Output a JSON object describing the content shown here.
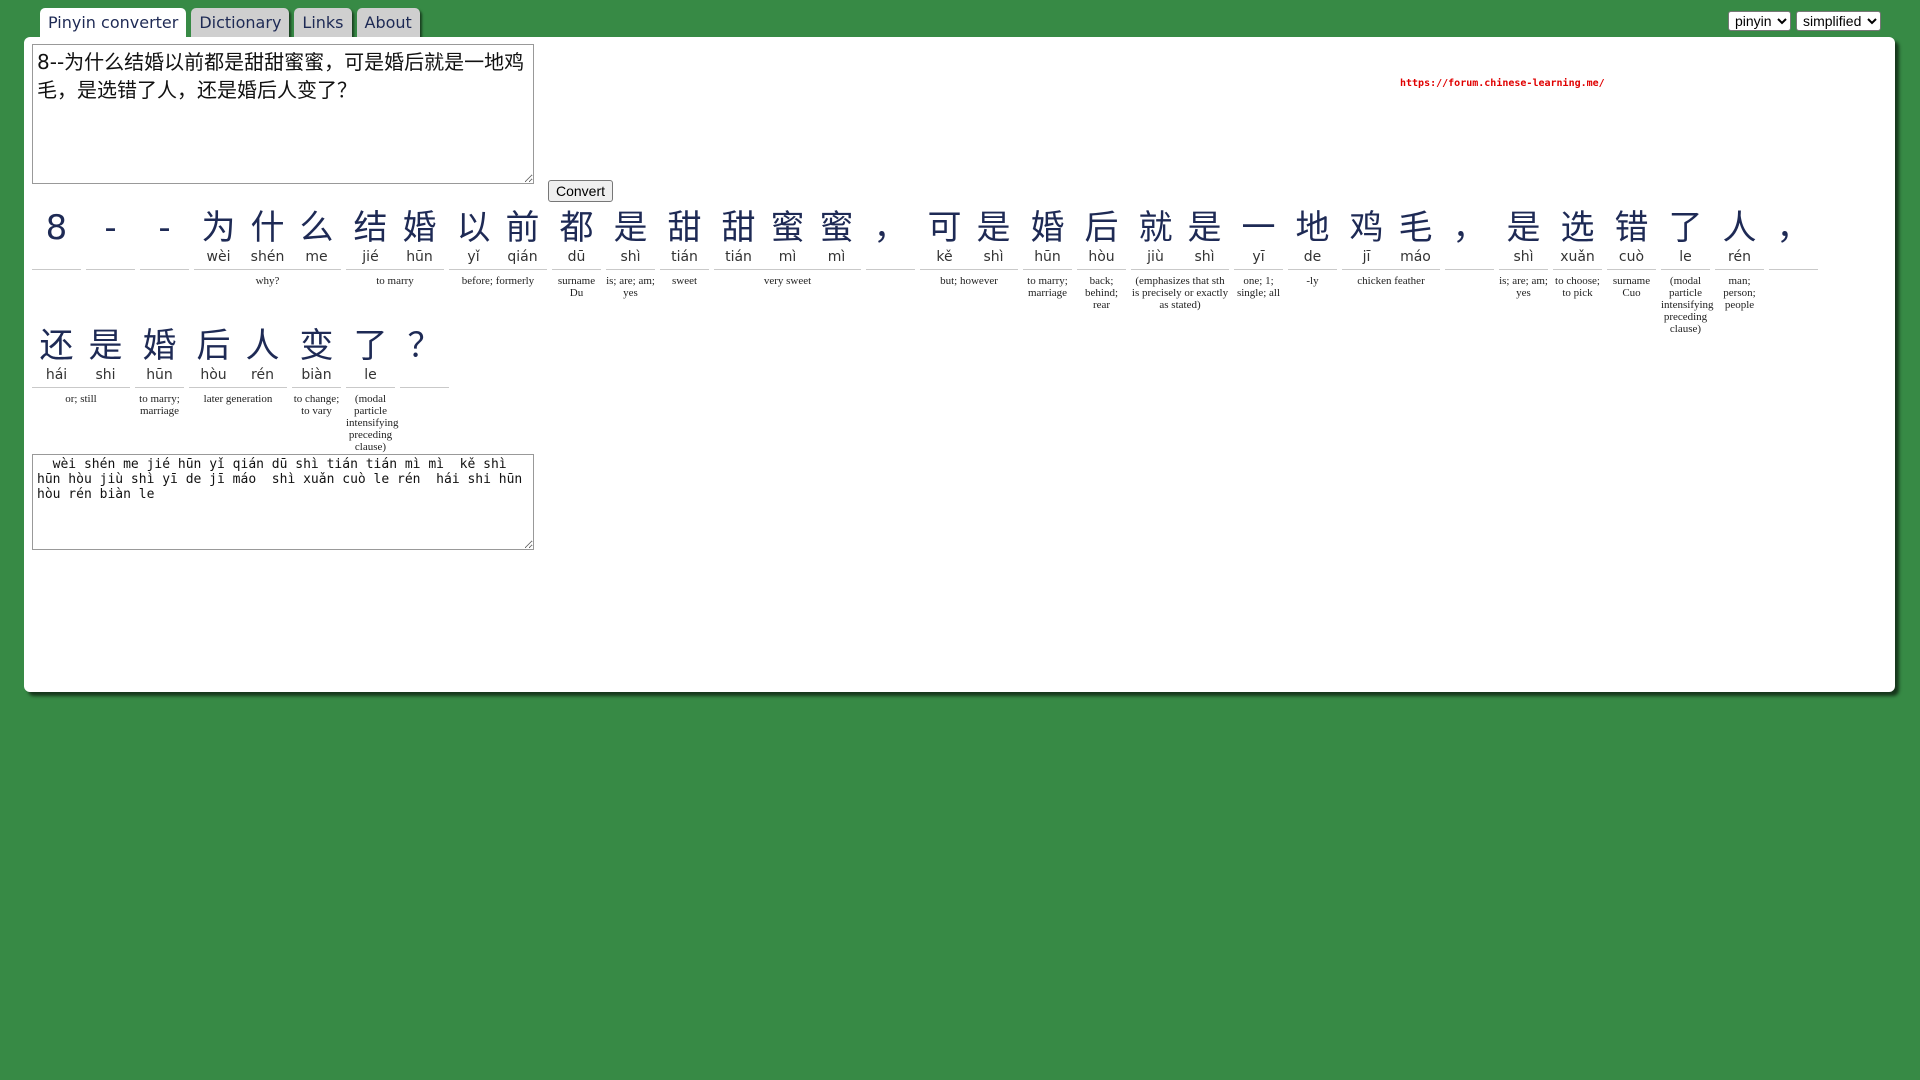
{
  "tabs": [
    {
      "label": "Pinyin converter",
      "active": true
    },
    {
      "label": "Dictionary",
      "active": false
    },
    {
      "label": "Links",
      "active": false
    },
    {
      "label": "About",
      "active": false
    }
  ],
  "selects": {
    "mode": {
      "value": "pinyin",
      "options": [
        "pinyin"
      ]
    },
    "script": {
      "value": "simplified",
      "options": [
        "simplified"
      ]
    }
  },
  "input_text": "8--为什么结婚以前都是甜甜蜜蜜，可是婚后就是一地鸡毛，是选错了人，还是婚后人变了？",
  "convert_label": "Convert",
  "forum_link": "https://forum.chinese-learning.me/",
  "rows": [
    {
      "groups": [
        {
          "chars": [
            {
              "hz": "8",
              "py": ""
            }
          ],
          "def": ""
        },
        {
          "chars": [
            {
              "hz": "-",
              "py": ""
            }
          ],
          "def": ""
        },
        {
          "chars": [
            {
              "hz": "-",
              "py": ""
            }
          ],
          "def": ""
        },
        {
          "chars": [
            {
              "hz": "为",
              "py": "wèi"
            },
            {
              "hz": "什",
              "py": "shén"
            },
            {
              "hz": "么",
              "py": "me"
            }
          ],
          "def": "why?"
        },
        {
          "chars": [
            {
              "hz": "结",
              "py": "jié"
            },
            {
              "hz": "婚",
              "py": "hūn"
            }
          ],
          "def": "to marry"
        },
        {
          "chars": [
            {
              "hz": "以",
              "py": "yǐ"
            },
            {
              "hz": "前",
              "py": "qián"
            }
          ],
          "def": "before; formerly"
        },
        {
          "chars": [
            {
              "hz": "都",
              "py": "dū"
            }
          ],
          "def": "surname Du"
        },
        {
          "chars": [
            {
              "hz": "是",
              "py": "shì"
            }
          ],
          "def": "is; are; am; yes"
        },
        {
          "chars": [
            {
              "hz": "甜",
              "py": "tián"
            }
          ],
          "def": "sweet"
        },
        {
          "chars": [
            {
              "hz": "甜",
              "py": "tián"
            },
            {
              "hz": "蜜",
              "py": "mì"
            },
            {
              "hz": "蜜",
              "py": "mì"
            }
          ],
          "def": "very sweet"
        },
        {
          "chars": [
            {
              "hz": "，",
              "py": ""
            }
          ],
          "def": ""
        },
        {
          "chars": [
            {
              "hz": "可",
              "py": "kě"
            },
            {
              "hz": "是",
              "py": "shì"
            }
          ],
          "def": "but; however"
        },
        {
          "chars": [
            {
              "hz": "婚",
              "py": "hūn"
            }
          ],
          "def": "to marry; marriage"
        },
        {
          "chars": [
            {
              "hz": "后",
              "py": "hòu"
            }
          ],
          "def": "back; behind; rear"
        },
        {
          "chars": [
            {
              "hz": "就",
              "py": "jiù"
            },
            {
              "hz": "是",
              "py": "shì"
            }
          ],
          "def": "(emphasizes that sth is precisely or exactly as stated)"
        },
        {
          "chars": [
            {
              "hz": "一",
              "py": "yī"
            }
          ],
          "def": "one; 1; single; all"
        },
        {
          "chars": [
            {
              "hz": "地",
              "py": "de"
            }
          ],
          "def": "-ly"
        },
        {
          "chars": [
            {
              "hz": "鸡",
              "py": "jī"
            },
            {
              "hz": "毛",
              "py": "máo"
            }
          ],
          "def": "chicken feather"
        },
        {
          "chars": [
            {
              "hz": "，",
              "py": ""
            }
          ],
          "def": ""
        },
        {
          "chars": [
            {
              "hz": "是",
              "py": "shì"
            }
          ],
          "def": "is; are; am; yes"
        },
        {
          "chars": [
            {
              "hz": "选",
              "py": "xuǎn"
            }
          ],
          "def": "to choose; to pick"
        },
        {
          "chars": [
            {
              "hz": "错",
              "py": "cuò"
            }
          ],
          "def": "surname Cuo"
        },
        {
          "chars": [
            {
              "hz": "了",
              "py": "le"
            }
          ],
          "def": "(modal particle intensifying preceding clause)"
        },
        {
          "chars": [
            {
              "hz": "人",
              "py": "rén"
            }
          ],
          "def": "man; person; people"
        },
        {
          "chars": [
            {
              "hz": "，",
              "py": ""
            }
          ],
          "def": ""
        }
      ]
    },
    {
      "groups": [
        {
          "chars": [
            {
              "hz": "还",
              "py": "hái"
            },
            {
              "hz": "是",
              "py": "shi"
            }
          ],
          "def": "or; still"
        },
        {
          "chars": [
            {
              "hz": "婚",
              "py": "hūn"
            }
          ],
          "def": "to marry; marriage"
        },
        {
          "chars": [
            {
              "hz": "后",
              "py": "hòu"
            },
            {
              "hz": "人",
              "py": "rén"
            }
          ],
          "def": "later generation"
        },
        {
          "chars": [
            {
              "hz": "变",
              "py": "biàn"
            }
          ],
          "def": "to change; to vary"
        },
        {
          "chars": [
            {
              "hz": "了",
              "py": "le"
            }
          ],
          "def": "(modal particle intensifying preceding clause)"
        },
        {
          "chars": [
            {
              "hz": "？",
              "py": ""
            }
          ],
          "def": ""
        }
      ]
    }
  ],
  "output_text": "  wèi shén me jié hūn yǐ qián dū shì tián tián mì mì  kě shì hūn hòu jiù shì yī de jī máo  shì xuǎn cuò le rén  hái shi hūn hòu rén biàn le"
}
